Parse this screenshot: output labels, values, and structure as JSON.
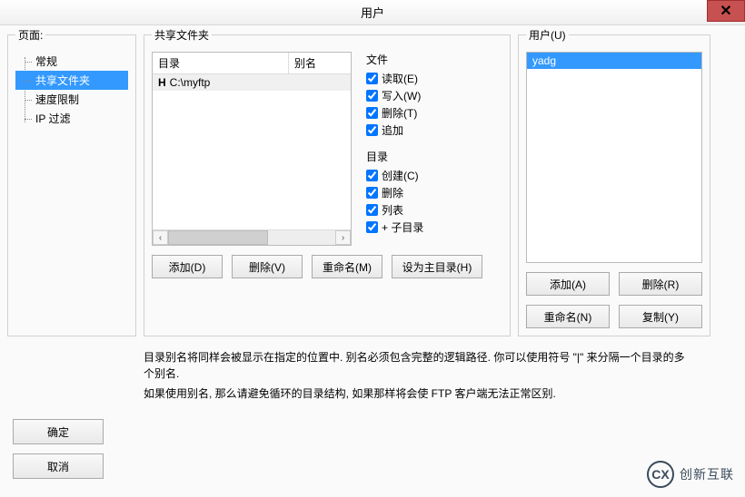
{
  "title": "用户",
  "page_section": {
    "label": "页面:",
    "items": [
      "常规",
      "共享文件夹",
      "速度限制",
      "IP 过滤"
    ],
    "selected_index": 1
  },
  "shared": {
    "label": "共享文件夹",
    "columns": {
      "dir": "目录",
      "alias": "别名"
    },
    "rows": [
      {
        "mark": "H",
        "path": "C:\\myftp",
        "alias": ""
      }
    ],
    "buttons": {
      "add": "添加(D)",
      "remove": "删除(V)",
      "rename": "重命名(M)",
      "set_home": "设为主目录(H)"
    }
  },
  "file_perms": {
    "label": "文件",
    "read": "读取(E)",
    "write": "写入(W)",
    "delete": "删除(T)",
    "append": "追加"
  },
  "dir_perms": {
    "label": "目录",
    "create": "创建(C)",
    "delete": "删除",
    "list": "列表",
    "subdirs": "+ 子目录"
  },
  "help": {
    "p1": "目录别名将同样会被显示在指定的位置中. 别名必须包含完整的逻辑路径. 你可以使用符号 \"|\" 来分隔一个目录的多个别名.",
    "p2": "如果使用别名, 那么请避免循环的目录结构, 如果那样将会使 FTP 客户端无法正常区别."
  },
  "users": {
    "label": "用户(U)",
    "items": [
      "yadg"
    ],
    "selected_index": 0,
    "buttons": {
      "add": "添加(A)",
      "remove": "删除(R)",
      "rename": "重命名(N)",
      "copy": "复制(Y)"
    }
  },
  "dialog_buttons": {
    "ok": "确定",
    "cancel": "取消"
  },
  "branding": {
    "mark": "CX",
    "name": "创新互联"
  }
}
